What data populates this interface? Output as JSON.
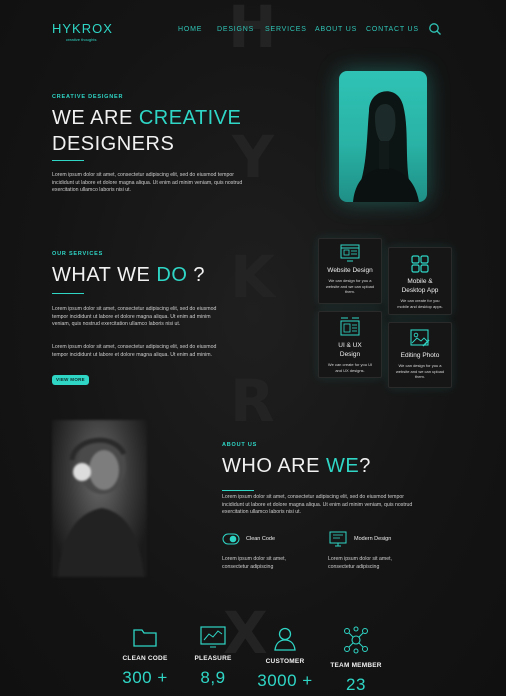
{
  "nav": {
    "brand": "HYKROX",
    "tagline": "creative thoughts",
    "links": [
      "HOME",
      "DESIGNS",
      "SERVICES",
      "ABOUT US",
      "CONTACT US"
    ]
  },
  "watermark": [
    "H",
    "Y",
    "K",
    "R",
    "X"
  ],
  "hero": {
    "eyebrow": "CREATIVE DESIGNER",
    "title_a": "WE ARE ",
    "title_b": "CREATIVE",
    "title_c": "DESIGNERS",
    "body": "Lorem ipsum dolor sit amet, consectetur adipiscing elit, sed do eiusmod tempor incididunt ut labore et dolore magna aliqua. Ut enim ad minim veniam, quis nostrud exercitation ullamco laboris nisi ut."
  },
  "services": {
    "eyebrow": "OUR SERVICES",
    "title_a": "WHAT WE ",
    "title_b": "DO",
    "title_c": " ?",
    "body1": "Lorem ipsum dolor sit amet, consectetur adipiscing elit, sed do eiusmod tempor incididunt ut labore et dolore magna aliqua. Ut enim ad minim veniam, quis nostrud exercitation ullamco laboris nisi ut.",
    "body2": "Lorem ipsum dolor sit amet, consectetur adipiscing elit, sed do eiusmod tempor incididunt ut labore et dolore magna aliqua. Ut enim ad minim.",
    "button": "VIEW MORE",
    "cards": [
      {
        "title": "Website Design",
        "desc": "We can design for you a website and we can upload them."
      },
      {
        "title": "Mobile & Desktop App",
        "desc": "We can create for you mobile and desktop apps."
      },
      {
        "title": "UI & UX Design",
        "desc": "We can create for you UI and UX designs."
      },
      {
        "title": "Editing Photo",
        "desc": "We can design for you a website and we can upload them."
      }
    ]
  },
  "about": {
    "eyebrow": "ABOUT US",
    "title_a": "WHO ARE ",
    "title_b": "WE",
    "title_c": "?",
    "body": "Lorem ipsum dolor sit amet, consectetur adipiscing elit, sed do eiusmod tempor incididunt ut labore et dolore magna aliqua. Ut enim ad minim veniam, quis nostrud exercitation ullamco laboris nisi ut.",
    "features": [
      {
        "title": "Clean Code",
        "desc": "Lorem ipsum dolor sit amet, consectetur adipiscing"
      },
      {
        "title": "Modern Design",
        "desc": "Lorem ipsum dolor sit amet, consectetur adipiscing"
      }
    ]
  },
  "stats": [
    {
      "label": "CLEAN CODE",
      "value": "300 +"
    },
    {
      "label": "PLEASURE",
      "value": "8,9"
    },
    {
      "label": "CUSTOMER",
      "value": "3000 +"
    },
    {
      "label": "TEAM MEMBER",
      "value": "23"
    }
  ],
  "colors": {
    "accent": "#2fd6c6",
    "background": "#131313"
  }
}
